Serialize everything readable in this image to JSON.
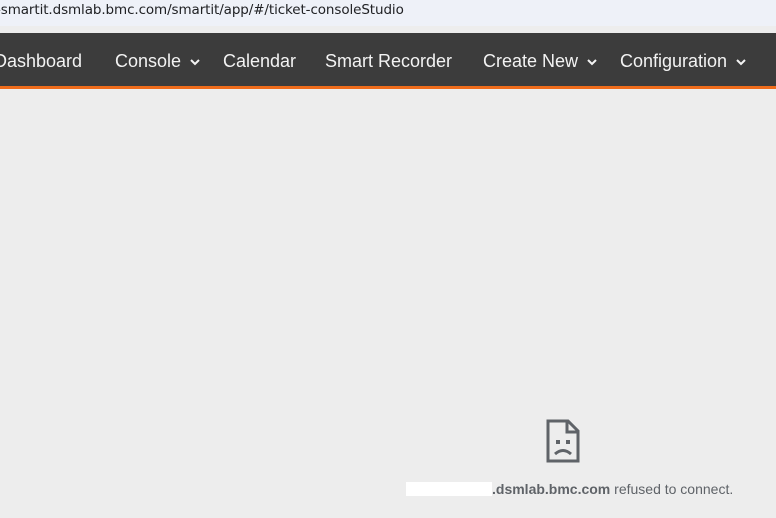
{
  "browser": {
    "url": "-smartit.dsmlab.bmc.com/smartit/app/#/ticket-consoleStudio"
  },
  "nav": {
    "items": [
      {
        "label": "Dashboard",
        "has_dropdown": false
      },
      {
        "label": "Console",
        "has_dropdown": true
      },
      {
        "label": "Calendar",
        "has_dropdown": false
      },
      {
        "label": "Smart Recorder",
        "has_dropdown": false
      },
      {
        "label": "Create New",
        "has_dropdown": true
      },
      {
        "label": "Configuration",
        "has_dropdown": true
      }
    ],
    "dropdown_icon": "chevron-down-icon",
    "accent_color": "#ef6c1b",
    "background_color": "#3c3c3c"
  },
  "frame_error": {
    "icon": "broken-page-sad-icon",
    "host": ".dsmlab.bmc.com",
    "message": " refused to connect."
  }
}
